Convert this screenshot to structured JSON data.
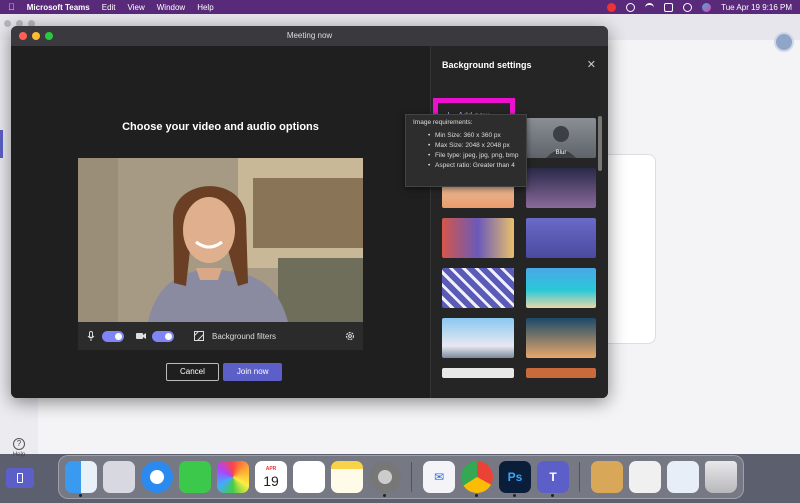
{
  "menubar": {
    "app_name": "Microsoft Teams",
    "items": [
      "Edit",
      "View",
      "Window",
      "Help"
    ],
    "clock": "Tue Apr 19  9:16 PM"
  },
  "sidebar": {
    "help_label": "Help"
  },
  "meeting": {
    "window_title": "Meeting now",
    "heading": "Choose your video and audio options",
    "mic_on": true,
    "camera_on": true,
    "background_filters_label": "Background filters",
    "cancel_label": "Cancel",
    "join_label": "Join now"
  },
  "background_settings": {
    "title": "Background settings",
    "add_new_label": "Add new",
    "blur_label": "Blur",
    "tooltip": {
      "title": "Image requirements:",
      "items": [
        "Min Size: 360 x 360 px",
        "Max Size: 2048 x 2048 px",
        "File type: jpeg, jpg, png, bmp",
        "Aspect ratio: Greater than 4"
      ]
    }
  },
  "dock": {
    "calendar_month": "APR",
    "calendar_day": "19",
    "apps": [
      "finder-icon",
      "launchpad-icon",
      "safari-icon",
      "messages-icon",
      "photos-icon",
      "calendar-icon",
      "reminders-icon",
      "notes-icon",
      "system-preferences-icon",
      "mail-icon",
      "chrome-icon",
      "photoshop-icon",
      "teams-icon",
      "archive-icon",
      "documents-icon",
      "downloads-icon",
      "trash-icon"
    ]
  },
  "colors": {
    "accent": "#5b5fc7",
    "highlight": "#ee10cf",
    "menubar": "#5a2a7a"
  }
}
